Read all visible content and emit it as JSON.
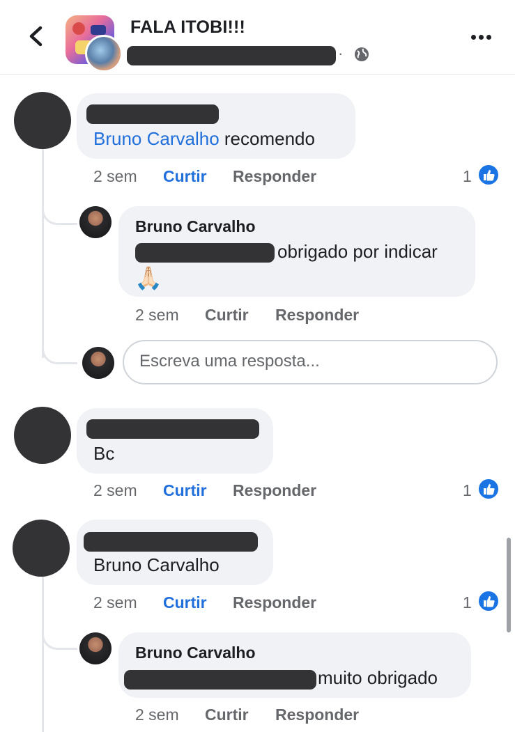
{
  "header": {
    "title": "FALA ITOBI!!!",
    "separator": "·",
    "icons": {
      "back": "chevron-left-icon",
      "privacy": "globe-icon",
      "more": "more-dots-icon"
    }
  },
  "comments": [
    {
      "text_link": "Bruno Carvalho",
      "text": "recomendo",
      "time": "2 sem",
      "like_label": "Curtir",
      "reply_label": "Responder",
      "reactions": "1"
    },
    {
      "author": "Bruno Carvalho",
      "text": "obrigado por indicar",
      "emoji": "🙏🏻",
      "time": "2 sem",
      "like_label": "Curtir",
      "reply_label": "Responder"
    },
    {
      "text": "Bc",
      "time": "2 sem",
      "like_label": "Curtir",
      "reply_label": "Responder",
      "reactions": "1"
    },
    {
      "text_link": "Bruno Carvalho",
      "time": "2 sem",
      "like_label": "Curtir",
      "reply_label": "Responder",
      "reactions": "1"
    },
    {
      "author": "Bruno Carvalho",
      "text": "muito obrigado",
      "time": "2 sem",
      "like_label": "Curtir",
      "reply_label": "Responder"
    }
  ],
  "reply_box": {
    "placeholder": "Escreva uma resposta..."
  },
  "colors": {
    "link": "#216fdb",
    "bubble": "#f0f2f5",
    "redaction": "#333335"
  }
}
